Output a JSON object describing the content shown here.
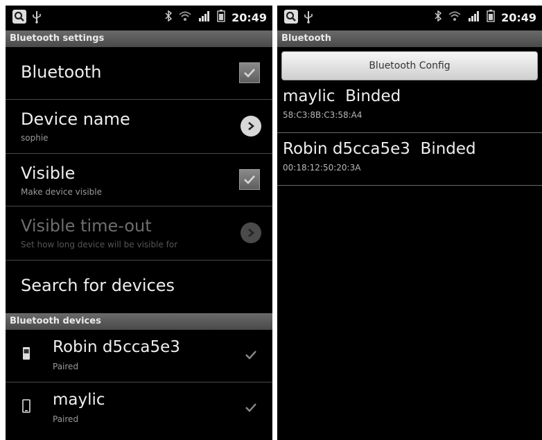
{
  "left_screen": {
    "status_bar": {
      "time": "20:49",
      "icons": [
        "search-icon",
        "usb-icon",
        "bluetooth-icon",
        "wifi-icon",
        "signal-icon",
        "battery-icon"
      ]
    },
    "title": "Bluetooth settings",
    "prefs": {
      "bluetooth": {
        "title": "Bluetooth",
        "checked": true
      },
      "device_name": {
        "title": "Device name",
        "summary": "sophie"
      },
      "visible": {
        "title": "Visible",
        "summary": "Make device visible",
        "checked": true
      },
      "visible_timeout": {
        "title": "Visible time-out",
        "summary": "Set how long device will be visible for",
        "enabled": false
      },
      "search": {
        "title": "Search for devices"
      }
    },
    "devices_header": "Bluetooth devices",
    "devices": [
      {
        "name": "Robin d5cca5e3",
        "status": "Paired",
        "icon": "phone-icon"
      },
      {
        "name": "maylic",
        "status": "Paired",
        "icon": "phone-icon"
      }
    ]
  },
  "right_screen": {
    "status_bar": {
      "time": "20:49",
      "icons": [
        "search-icon",
        "usb-icon",
        "bluetooth-icon",
        "wifi-icon",
        "signal-icon",
        "battery-icon"
      ]
    },
    "title": "Bluetooth",
    "config_button": "Bluetooth Config",
    "bound_devices": [
      {
        "name": "maylic  Binded",
        "mac": "58:C3:8B:C3:58:A4"
      },
      {
        "name": "Robin d5cca5e3  Binded",
        "mac": "00:18:12:50:20:3A"
      }
    ]
  },
  "colors": {
    "background": "#000000",
    "title_bar": "#5a5a5a",
    "text": "#eeeeee",
    "summary": "#9a9a9a"
  }
}
